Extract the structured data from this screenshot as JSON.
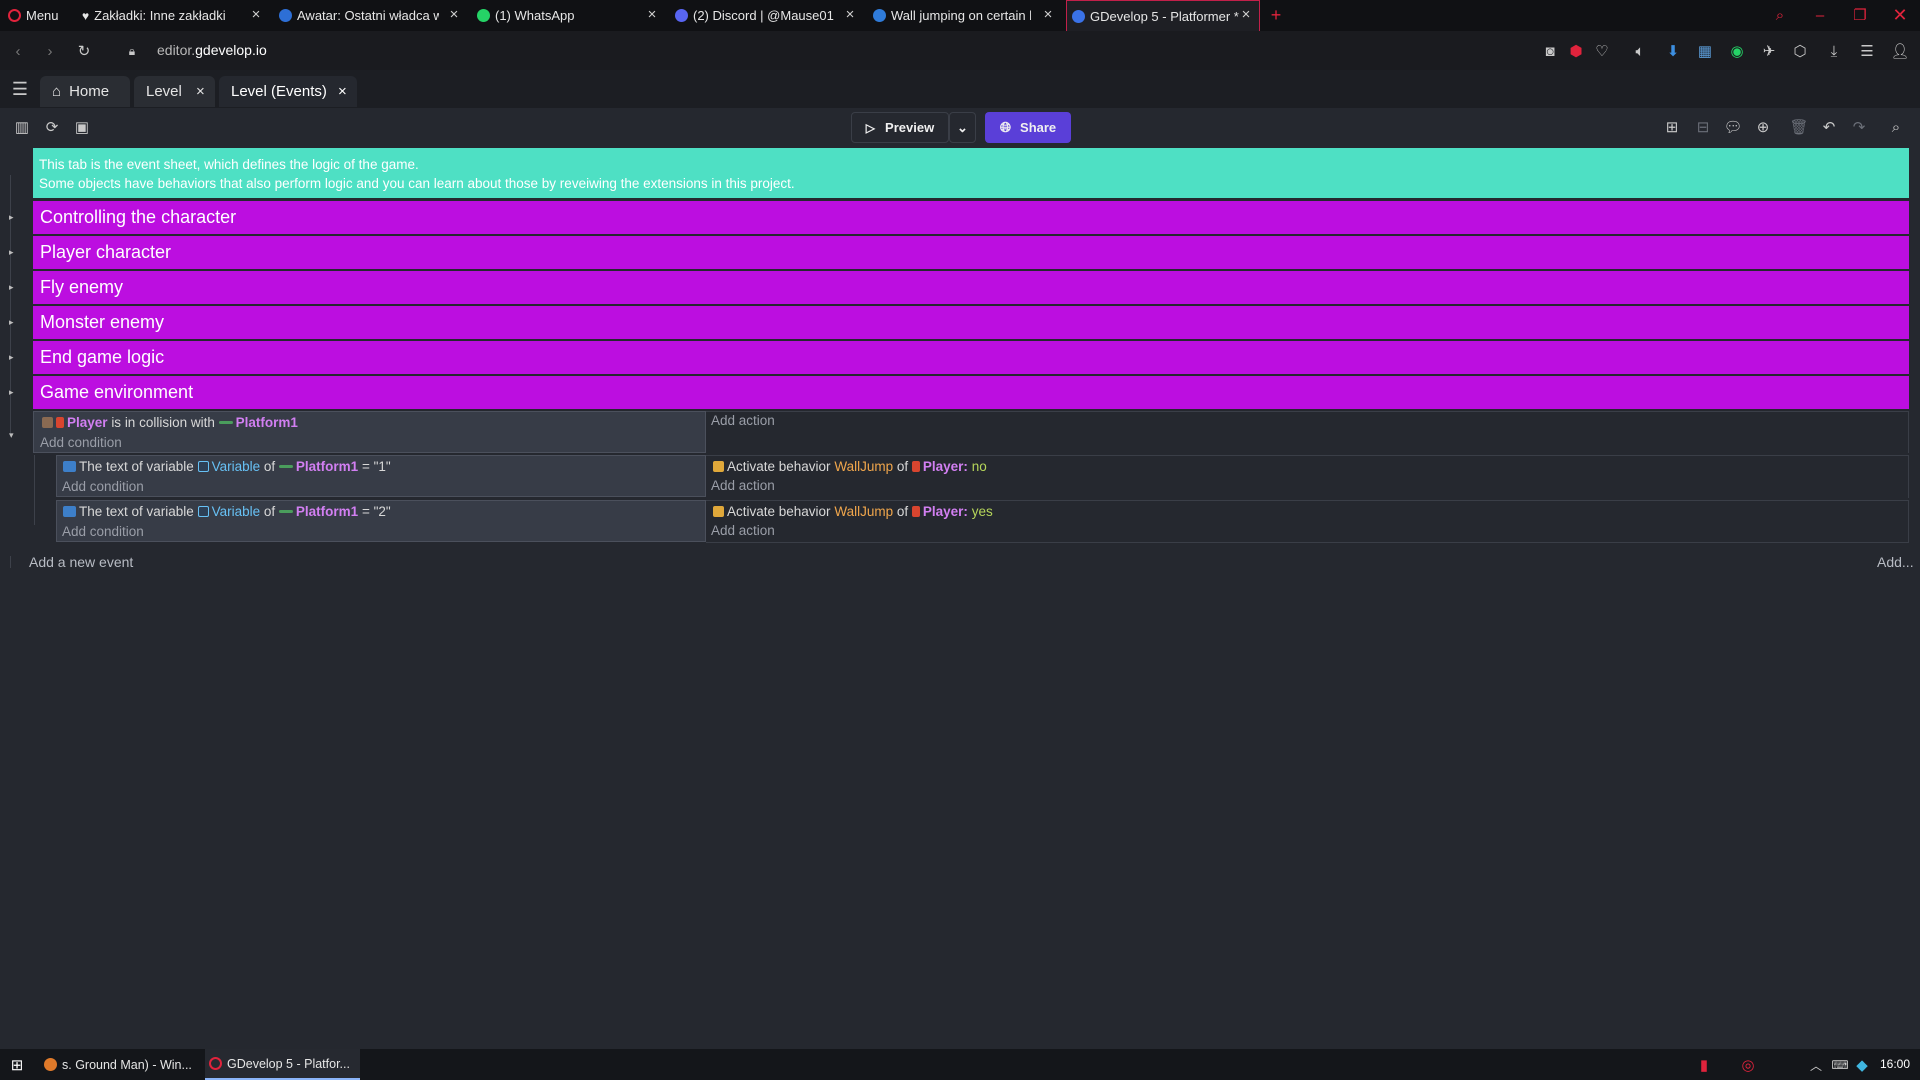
{
  "browser": {
    "menu_label": "Menu",
    "tabs": [
      {
        "title": "Zakładki: Inne zakładki"
      },
      {
        "title": "Awatar: Ostatni władca wiatru"
      },
      {
        "title": "(1) WhatsApp"
      },
      {
        "title": "(2) Discord | @Mause01"
      },
      {
        "title": "Wall jumping on certain blocks"
      },
      {
        "title": "GDevelop 5 - Platformer *"
      }
    ],
    "new_tab_symbol": "+",
    "url": {
      "prefix": "editor.",
      "domain": "gdevelop.io"
    }
  },
  "editor_tabs": [
    {
      "label": "Home"
    },
    {
      "label": "Level"
    },
    {
      "label": "Level (Events)"
    }
  ],
  "toolbar": {
    "preview_label": "Preview",
    "share_label": "Share"
  },
  "comment": {
    "line1": "This tab is the event sheet, which defines the logic of the game.",
    "line2": "Some objects have behaviors that also perform logic and you can learn about those by reveiwing the extensions in this project."
  },
  "groups": [
    {
      "label": "Controlling the character"
    },
    {
      "label": "Player character"
    },
    {
      "label": "Fly enemy"
    },
    {
      "label": "Monster enemy"
    },
    {
      "label": "End game logic"
    },
    {
      "label": "Game environment"
    }
  ],
  "event": {
    "condition": {
      "object": "Player",
      "text": "is in collision with",
      "target": "Platform1"
    },
    "add_condition": "Add condition",
    "add_action": "Add action",
    "subevents": [
      {
        "cond_prefix": "The text of variable",
        "cond_var": "Variable",
        "cond_of": "of",
        "cond_obj": "Platform1",
        "cond_eq": "= \"1\"",
        "act_prefix": "Activate behavior",
        "act_beh": "WallJump",
        "act_of": "of",
        "act_obj": "Player:",
        "act_val": "no"
      },
      {
        "cond_prefix": "The text of variable",
        "cond_var": "Variable",
        "cond_of": "of",
        "cond_obj": "Platform1",
        "cond_eq": "= \"2\"",
        "act_prefix": "Activate behavior",
        "act_beh": "WallJump",
        "act_of": "of",
        "act_obj": "Player:",
        "act_val": "yes"
      }
    ]
  },
  "add_new_event": "Add a new event",
  "add_more": "Add...",
  "taskbar": {
    "items": [
      {
        "label": "s. Ground Man) - Win..."
      },
      {
        "label": "GDevelop 5 - Platfor..."
      }
    ],
    "clock": "16:00"
  },
  "colors": {
    "comment_bg": "#4ee0c4",
    "group_bg": "#bc0ee0",
    "share_bg": "#5a3fd8",
    "active_tab_border": "#c2204a"
  }
}
